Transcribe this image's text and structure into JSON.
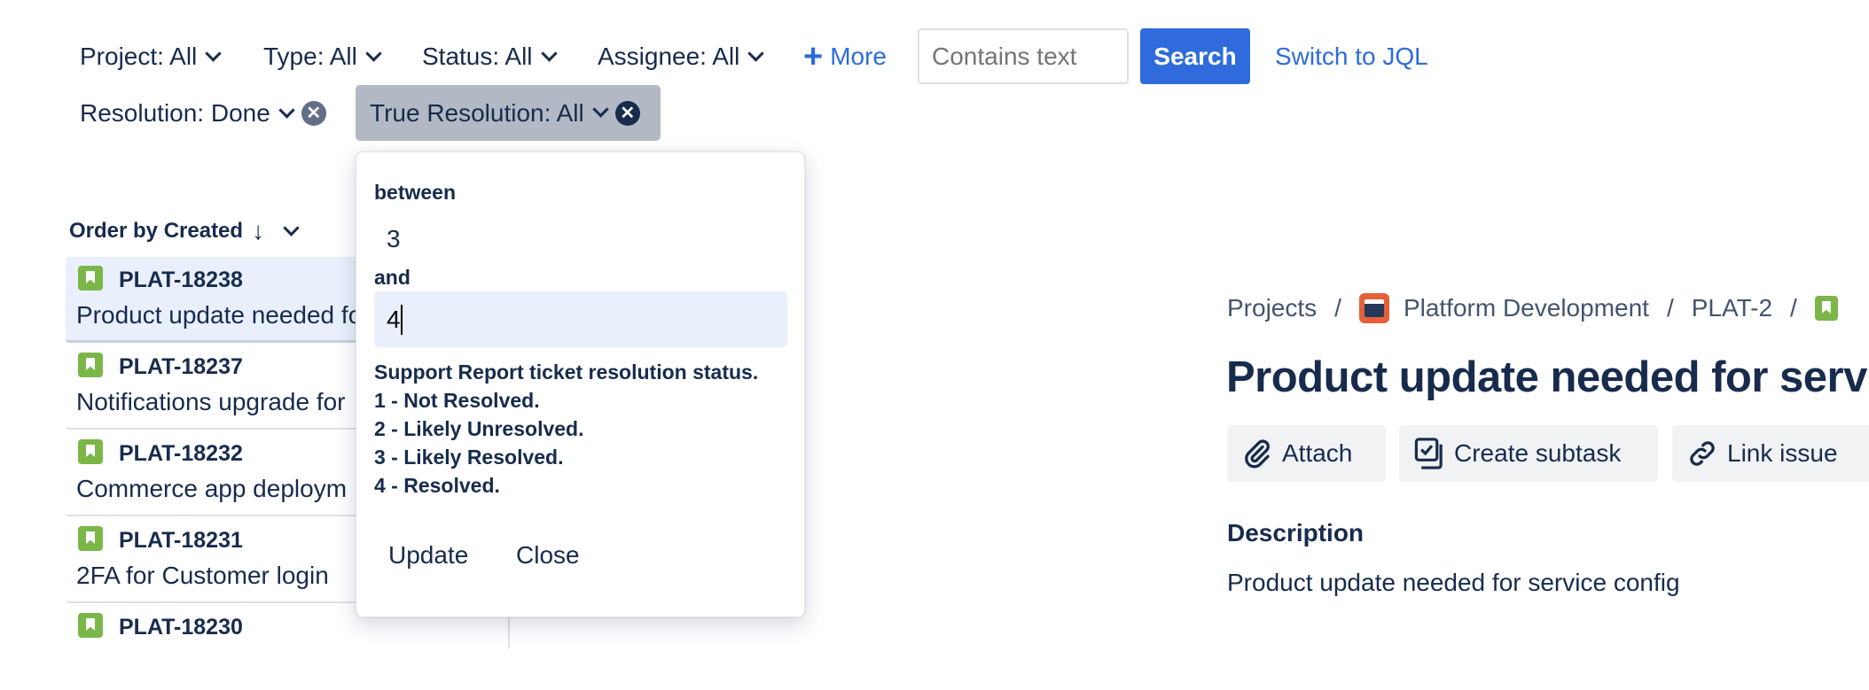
{
  "filters": {
    "project": "Project: All",
    "type": "Type: All",
    "status": "Status: All",
    "assignee": "Assignee: All",
    "more": "More",
    "search_placeholder": "Contains text",
    "search_button": "Search",
    "switch_jql": "Switch to JQL",
    "resolution": "Resolution: Done",
    "true_resolution": "True Resolution: All"
  },
  "colors": {
    "accent": "#2F6BDC",
    "link": "#2D6BDB",
    "chip_active_bg": "#B3B9C4",
    "selected_row_bg": "#E9F0FC",
    "story_icon": "#7AB648",
    "project_icon": "#E5603A"
  },
  "list": {
    "order_by": "Order by Created",
    "items": [
      {
        "key": "PLAT-18238",
        "summary": "Product update needed for service config",
        "icon": "story-icon",
        "selected": true
      },
      {
        "key": "PLAT-18237",
        "summary": "Notifications upgrade for",
        "icon": "story-icon"
      },
      {
        "key": "PLAT-18232",
        "summary": "Commerce app deploym",
        "icon": "story-icon"
      },
      {
        "key": "PLAT-18231",
        "summary": "2FA for Customer login",
        "icon": "story-icon"
      },
      {
        "key": "PLAT-18230",
        "summary": "",
        "icon": "story-icon"
      }
    ]
  },
  "popup": {
    "between_label": "between",
    "from_value": "3",
    "and_label": "and",
    "to_value": "4",
    "help_lines": [
      "Support Report ticket resolution status.",
      "1 - Not Resolved.",
      "2 - Likely Unresolved.",
      "3 - Likely Resolved.",
      "4 - Resolved."
    ],
    "update_button": "Update",
    "close_button": "Close"
  },
  "detail": {
    "breadcrumbs": {
      "projects": "Projects",
      "project": "Platform Development",
      "parent": "PLAT-2",
      "separator": "/"
    },
    "title": "Product update needed for service",
    "actions": {
      "attach": "Attach",
      "create_subtask": "Create subtask",
      "link_issue": "Link issue"
    },
    "description_heading": "Description",
    "description": "Product update needed for service config"
  }
}
